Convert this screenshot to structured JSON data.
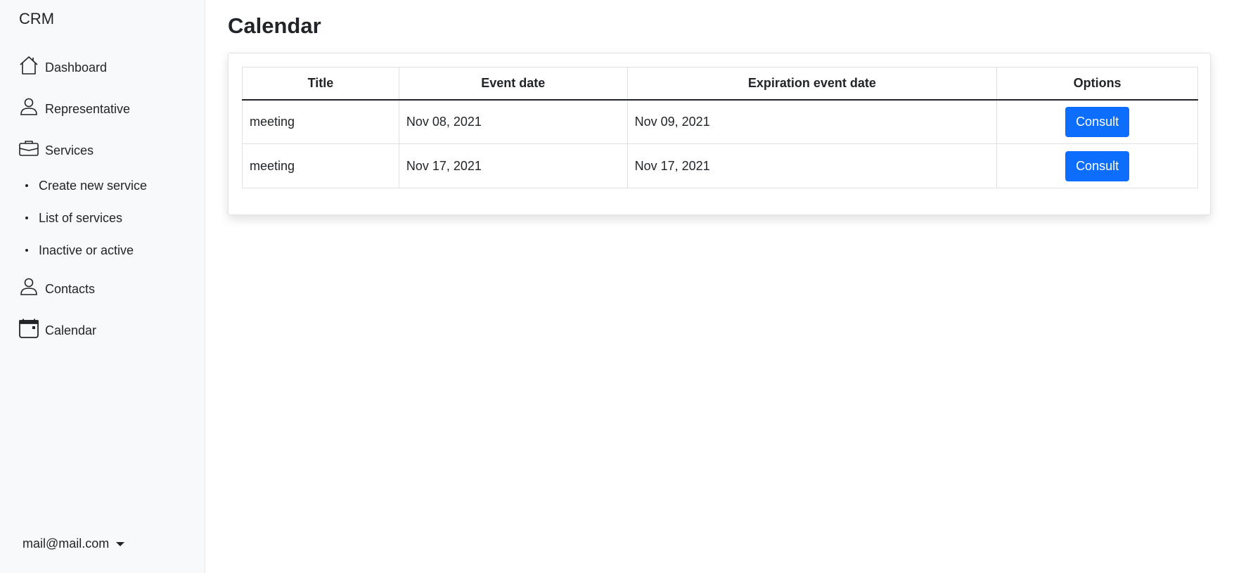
{
  "sidebar": {
    "brand": "CRM",
    "nav": [
      {
        "label": "Dashboard",
        "icon": "house-icon"
      },
      {
        "label": "Representative",
        "icon": "person-icon"
      },
      {
        "label": "Services",
        "icon": "briefcase-icon"
      },
      {
        "label": "Contacts",
        "icon": "person-icon"
      },
      {
        "label": "Calendar",
        "icon": "calendar-icon"
      }
    ],
    "services_sub": [
      {
        "label": "Create new service"
      },
      {
        "label": "List of services"
      },
      {
        "label": "Inactive or active"
      }
    ],
    "user_email": "mail@mail.com"
  },
  "main": {
    "title": "Calendar",
    "table": {
      "columns": [
        "Title",
        "Event date",
        "Expiration event date",
        "Options"
      ],
      "rows": [
        {
          "title": "meeting",
          "event_date": "Nov 08, 2021",
          "expiration_date": "Nov 09, 2021",
          "action": "Consult"
        },
        {
          "title": "meeting",
          "event_date": "Nov 17, 2021",
          "expiration_date": "Nov 17, 2021",
          "action": "Consult"
        }
      ]
    }
  },
  "colors": {
    "sidebar_bg": "#f8f9fa",
    "primary": "#0d6efd",
    "text": "#212529"
  }
}
